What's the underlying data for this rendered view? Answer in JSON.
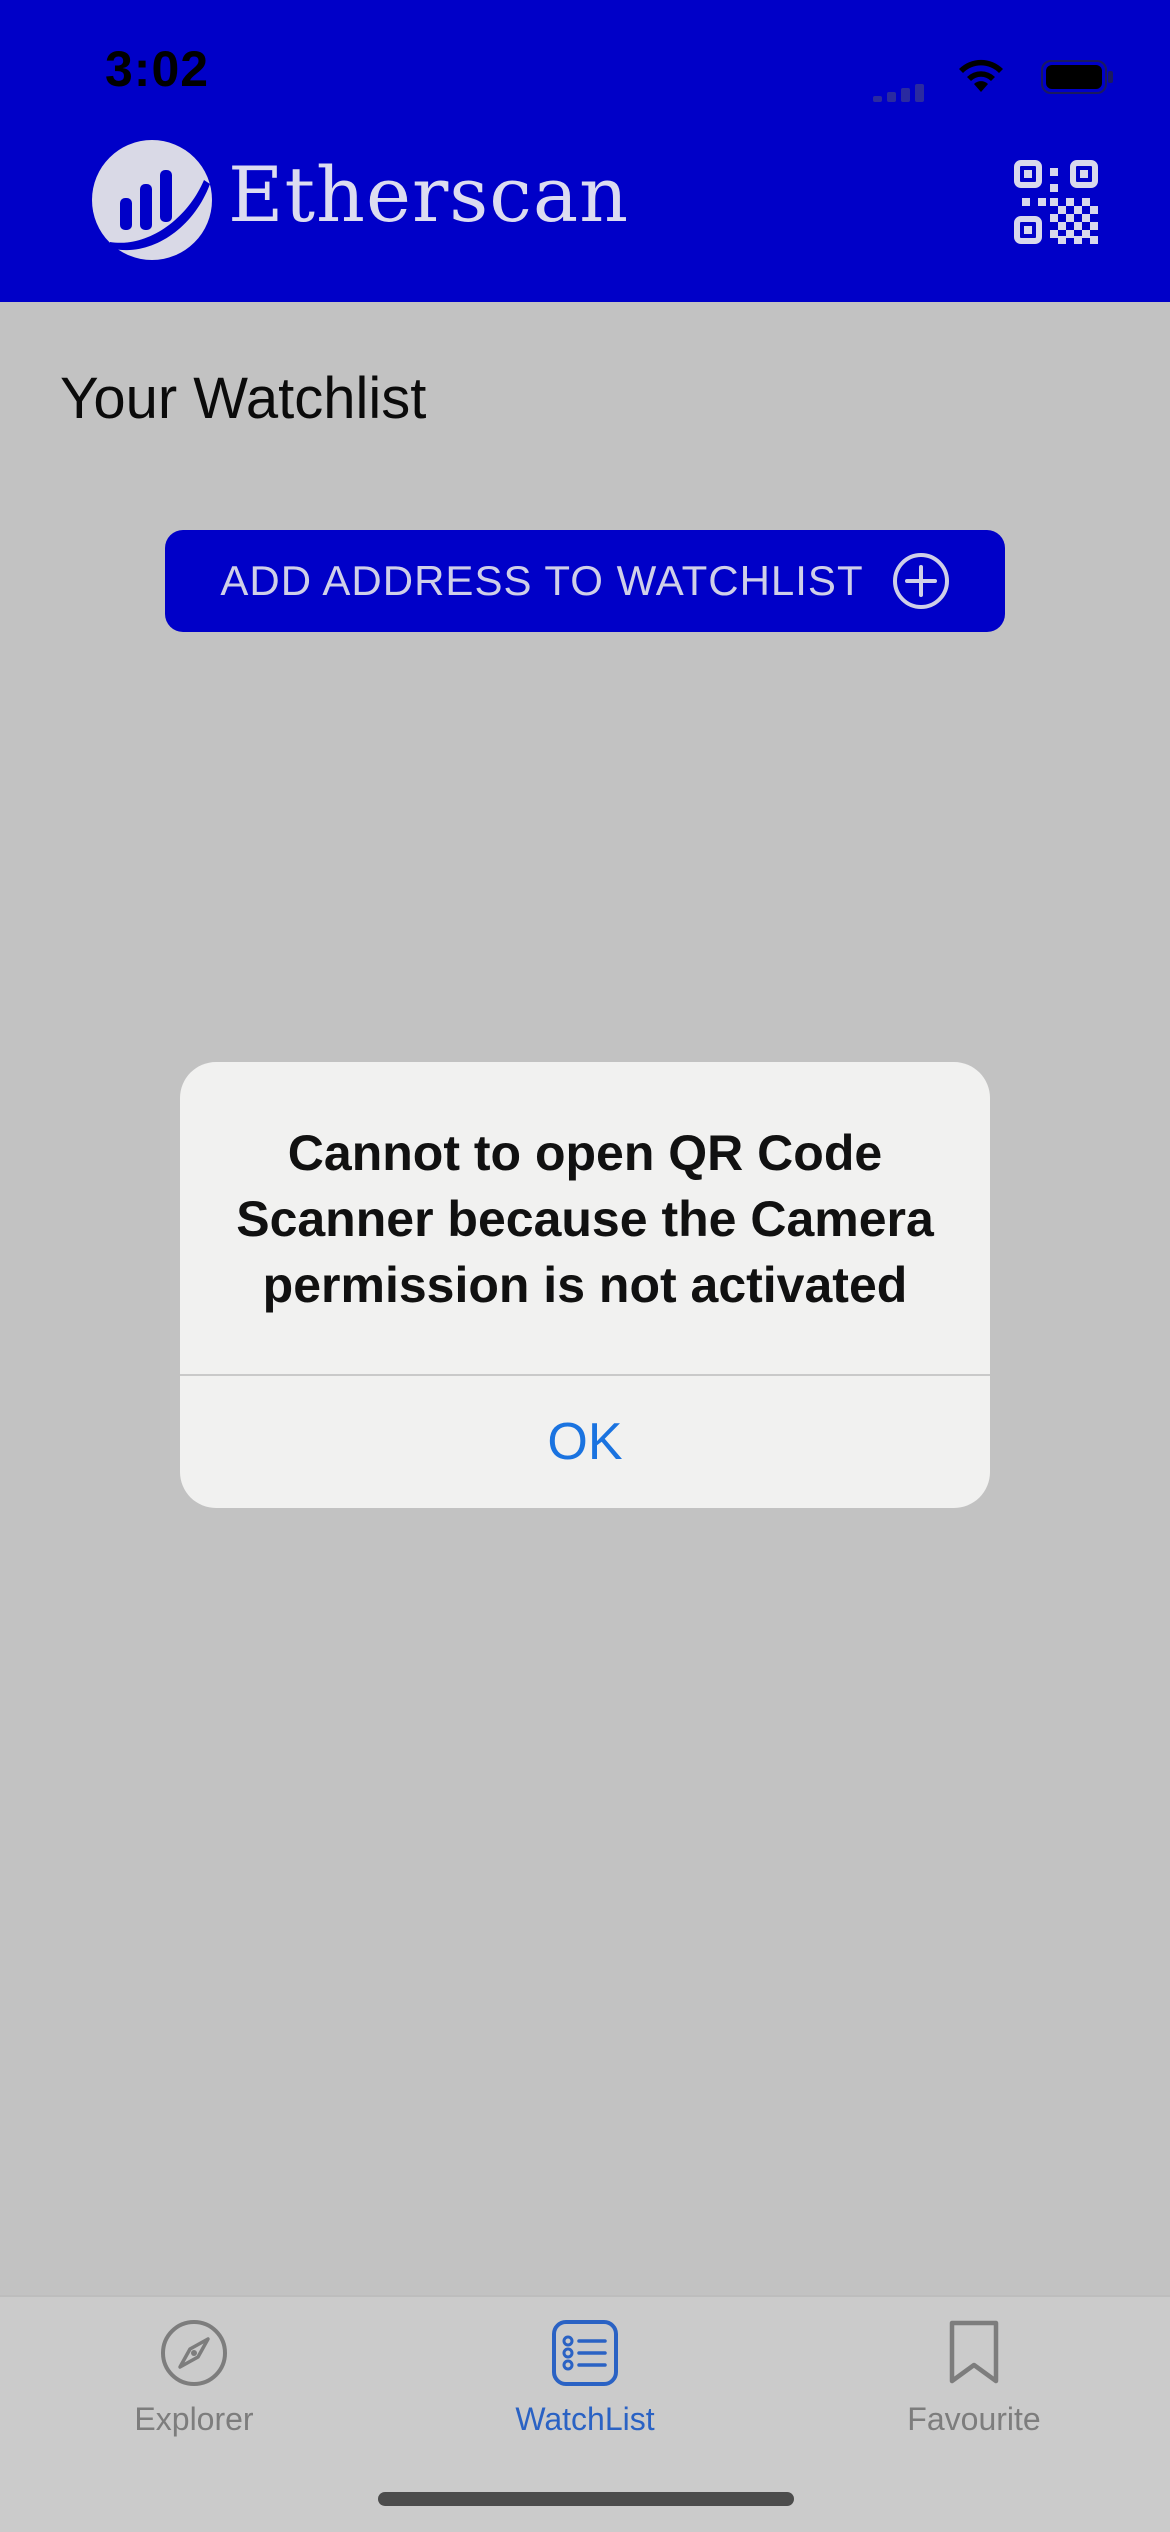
{
  "status_bar": {
    "time": "3:02"
  },
  "header": {
    "brand_name": "Etherscan",
    "logo_icon": "etherscan-logo",
    "qr_icon": "qr-code-icon"
  },
  "main": {
    "title": "Your Watchlist",
    "add_button_label": "ADD ADDRESS TO WATCHLIST",
    "add_button_icon": "plus-circle-icon"
  },
  "alert": {
    "message": "Cannot to open QR Code Scanner because the Camera permission is not activated",
    "ok_label": "OK"
  },
  "tab_bar": {
    "tabs": [
      {
        "label": "Explorer",
        "icon": "compass-icon",
        "active": false
      },
      {
        "label": "WatchList",
        "icon": "list-icon",
        "active": true
      },
      {
        "label": "Favourite",
        "icon": "bookmark-icon",
        "active": false
      }
    ]
  },
  "colors": {
    "brand_blue": "#0000c8",
    "dim_background": "#c2c2c2",
    "alert_background": "#f1f1f0",
    "link_blue": "#1a73e0",
    "active_tab": "#2a62c4",
    "inactive_tab": "#7d7d7d"
  }
}
